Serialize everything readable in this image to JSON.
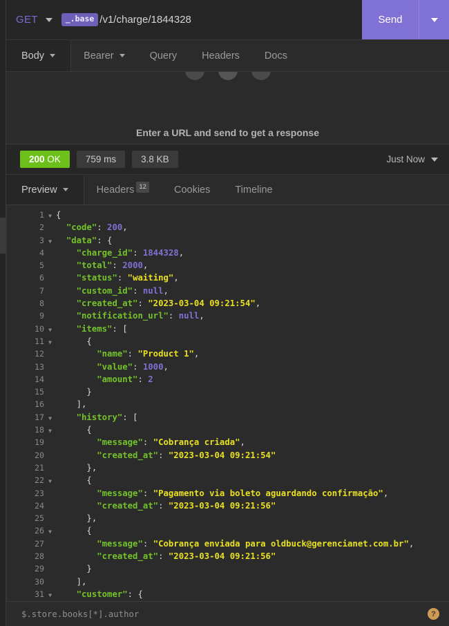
{
  "request_bar": {
    "method": "GET",
    "env_chip": "_.base",
    "url_path": "/v1/charge/1844328",
    "send_label": "Send"
  },
  "request_tabs": [
    {
      "label": "Body",
      "has_caret": true,
      "active": true
    },
    {
      "label": "Bearer",
      "has_caret": true,
      "active": false
    },
    {
      "label": "Query",
      "has_caret": false,
      "active": false
    },
    {
      "label": "Headers",
      "has_caret": false,
      "active": false
    },
    {
      "label": "Docs",
      "has_caret": false,
      "active": false
    }
  ],
  "empty_state": {
    "message": "Enter a URL and send to get a response"
  },
  "status_bar": {
    "status_code": "200",
    "status_text": "OK",
    "time": "759 ms",
    "size": "3.8 KB",
    "timestamp": "Just Now"
  },
  "response_tabs": [
    {
      "label": "Preview",
      "has_caret": true,
      "badge": "",
      "active": true
    },
    {
      "label": "Headers",
      "has_caret": false,
      "badge": "12",
      "active": false
    },
    {
      "label": "Cookies",
      "has_caret": false,
      "badge": "",
      "active": false
    },
    {
      "label": "Timeline",
      "has_caret": false,
      "badge": "",
      "active": false
    }
  ],
  "footer": {
    "filter_placeholder": "$.store.books[*].author",
    "help_label": "?"
  },
  "code_lines": [
    {
      "num": "1",
      "fold": true,
      "indent": 0,
      "tokens": [
        [
          "p",
          "{"
        ]
      ]
    },
    {
      "num": "2",
      "fold": false,
      "indent": 1,
      "tokens": [
        [
          "k",
          "\"code\""
        ],
        [
          "p",
          ": "
        ],
        [
          "n",
          "200"
        ],
        [
          "p",
          ","
        ]
      ]
    },
    {
      "num": "3",
      "fold": true,
      "indent": 1,
      "tokens": [
        [
          "k",
          "\"data\""
        ],
        [
          "p",
          ": {"
        ]
      ]
    },
    {
      "num": "4",
      "fold": false,
      "indent": 2,
      "tokens": [
        [
          "k",
          "\"charge_id\""
        ],
        [
          "p",
          ": "
        ],
        [
          "n",
          "1844328"
        ],
        [
          "p",
          ","
        ]
      ]
    },
    {
      "num": "5",
      "fold": false,
      "indent": 2,
      "tokens": [
        [
          "k",
          "\"total\""
        ],
        [
          "p",
          ": "
        ],
        [
          "n",
          "2000"
        ],
        [
          "p",
          ","
        ]
      ]
    },
    {
      "num": "6",
      "fold": false,
      "indent": 2,
      "tokens": [
        [
          "k",
          "\"status\""
        ],
        [
          "p",
          ": "
        ],
        [
          "s",
          "\"waiting\""
        ],
        [
          "p",
          ","
        ]
      ]
    },
    {
      "num": "7",
      "fold": false,
      "indent": 2,
      "tokens": [
        [
          "k",
          "\"custom_id\""
        ],
        [
          "p",
          ": "
        ],
        [
          "nul",
          "null"
        ],
        [
          "p",
          ","
        ]
      ]
    },
    {
      "num": "8",
      "fold": false,
      "indent": 2,
      "tokens": [
        [
          "k",
          "\"created_at\""
        ],
        [
          "p",
          ": "
        ],
        [
          "s",
          "\"2023-03-04 09:21:54\""
        ],
        [
          "p",
          ","
        ]
      ]
    },
    {
      "num": "9",
      "fold": false,
      "indent": 2,
      "tokens": [
        [
          "k",
          "\"notification_url\""
        ],
        [
          "p",
          ": "
        ],
        [
          "nul",
          "null"
        ],
        [
          "p",
          ","
        ]
      ]
    },
    {
      "num": "10",
      "fold": true,
      "indent": 2,
      "tokens": [
        [
          "k",
          "\"items\""
        ],
        [
          "p",
          ": ["
        ]
      ]
    },
    {
      "num": "11",
      "fold": true,
      "indent": 3,
      "tokens": [
        [
          "p",
          "{"
        ]
      ]
    },
    {
      "num": "12",
      "fold": false,
      "indent": 4,
      "tokens": [
        [
          "k",
          "\"name\""
        ],
        [
          "p",
          ": "
        ],
        [
          "s",
          "\"Product 1\""
        ],
        [
          "p",
          ","
        ]
      ]
    },
    {
      "num": "13",
      "fold": false,
      "indent": 4,
      "tokens": [
        [
          "k",
          "\"value\""
        ],
        [
          "p",
          ": "
        ],
        [
          "n",
          "1000"
        ],
        [
          "p",
          ","
        ]
      ]
    },
    {
      "num": "14",
      "fold": false,
      "indent": 4,
      "tokens": [
        [
          "k",
          "\"amount\""
        ],
        [
          "p",
          ": "
        ],
        [
          "n",
          "2"
        ]
      ]
    },
    {
      "num": "15",
      "fold": false,
      "indent": 3,
      "tokens": [
        [
          "p",
          "}"
        ]
      ]
    },
    {
      "num": "16",
      "fold": false,
      "indent": 2,
      "tokens": [
        [
          "p",
          "],"
        ]
      ]
    },
    {
      "num": "17",
      "fold": true,
      "indent": 2,
      "tokens": [
        [
          "k",
          "\"history\""
        ],
        [
          "p",
          ": ["
        ]
      ]
    },
    {
      "num": "18",
      "fold": true,
      "indent": 3,
      "tokens": [
        [
          "p",
          "{"
        ]
      ]
    },
    {
      "num": "19",
      "fold": false,
      "indent": 4,
      "tokens": [
        [
          "k",
          "\"message\""
        ],
        [
          "p",
          ": "
        ],
        [
          "s",
          "\"Cobrança criada\""
        ],
        [
          "p",
          ","
        ]
      ]
    },
    {
      "num": "20",
      "fold": false,
      "indent": 4,
      "tokens": [
        [
          "k",
          "\"created_at\""
        ],
        [
          "p",
          ": "
        ],
        [
          "s",
          "\"2023-03-04 09:21:54\""
        ]
      ]
    },
    {
      "num": "21",
      "fold": false,
      "indent": 3,
      "tokens": [
        [
          "p",
          "},"
        ]
      ]
    },
    {
      "num": "22",
      "fold": true,
      "indent": 3,
      "tokens": [
        [
          "p",
          "{"
        ]
      ]
    },
    {
      "num": "23",
      "fold": false,
      "indent": 4,
      "tokens": [
        [
          "k",
          "\"message\""
        ],
        [
          "p",
          ": "
        ],
        [
          "s",
          "\"Pagamento via boleto aguardando confirmação\""
        ],
        [
          "p",
          ","
        ]
      ]
    },
    {
      "num": "24",
      "fold": false,
      "indent": 4,
      "tokens": [
        [
          "k",
          "\"created_at\""
        ],
        [
          "p",
          ": "
        ],
        [
          "s",
          "\"2023-03-04 09:21:56\""
        ]
      ]
    },
    {
      "num": "25",
      "fold": false,
      "indent": 3,
      "tokens": [
        [
          "p",
          "},"
        ]
      ]
    },
    {
      "num": "26",
      "fold": true,
      "indent": 3,
      "tokens": [
        [
          "p",
          "{"
        ]
      ]
    },
    {
      "num": "27",
      "fold": false,
      "indent": 4,
      "tokens": [
        [
          "k",
          "\"message\""
        ],
        [
          "p",
          ": "
        ],
        [
          "s",
          "\"Cobrança enviada para oldbuck@gerencianet.com.br\""
        ],
        [
          "p",
          ","
        ]
      ]
    },
    {
      "num": "28",
      "fold": false,
      "indent": 4,
      "tokens": [
        [
          "k",
          "\"created_at\""
        ],
        [
          "p",
          ": "
        ],
        [
          "s",
          "\"2023-03-04 09:21:56\""
        ]
      ]
    },
    {
      "num": "29",
      "fold": false,
      "indent": 3,
      "tokens": [
        [
          "p",
          "}"
        ]
      ]
    },
    {
      "num": "30",
      "fold": false,
      "indent": 2,
      "tokens": [
        [
          "p",
          "],"
        ]
      ]
    },
    {
      "num": "31",
      "fold": true,
      "indent": 2,
      "tokens": [
        [
          "k",
          "\"customer\""
        ],
        [
          "p",
          ": {"
        ]
      ]
    }
  ]
}
